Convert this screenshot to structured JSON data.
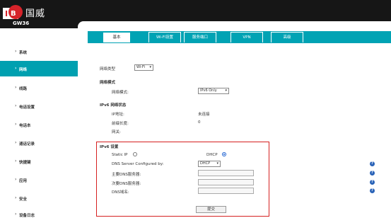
{
  "header": {
    "brand_cn": "国威",
    "model": "GW36"
  },
  "sidebar": {
    "items": [
      {
        "label": "系统",
        "active": false
      },
      {
        "label": "网络",
        "active": true
      },
      {
        "label": "线路",
        "active": false
      },
      {
        "label": "电话设置",
        "active": false
      },
      {
        "label": "电话本",
        "active": false
      },
      {
        "label": "通话记录",
        "active": false
      },
      {
        "label": "快捷键",
        "active": false
      },
      {
        "label": "应用",
        "active": false
      },
      {
        "label": "安全",
        "active": false
      },
      {
        "label": "设备日志",
        "active": false
      }
    ]
  },
  "tabs": [
    "基本",
    "Wi-Fi设置",
    "服务端口",
    "VPN",
    "高级"
  ],
  "form": {
    "network_type_label": "网络类型",
    "network_type_value": "Wi-Fi",
    "network_mode_title": "网络模式",
    "network_mode_label": "网络模式:",
    "network_mode_value": "IPv6 Only",
    "ipv6_status_title": "IPv6 网络状态",
    "ip_address_label": "IP地址:",
    "ip_address_value": "未连接",
    "prefix_label": "前缀长度:",
    "prefix_value": "0",
    "gateway_label": "网关:",
    "gateway_value": "",
    "ipv6_settings_title": "IPv6 设置",
    "static_ip_label": "Static IP",
    "dhcp_label": "DHCP",
    "dns_configured_label": "DNS Server Configured by:",
    "dns_configured_value": "DHCP",
    "primary_dns_label": "主要DNS服务器:",
    "secondary_dns_label": "次要DNS服务器:",
    "dns_domain_label": "DNS域名:",
    "primary_dns_value": "",
    "secondary_dns_value": "",
    "dns_domain_value": "",
    "submit_label": "提交"
  },
  "help_glyph": "?",
  "colors": {
    "accent": "#00a3b4",
    "highlight": "#d62020",
    "help": "#2a63b8"
  }
}
